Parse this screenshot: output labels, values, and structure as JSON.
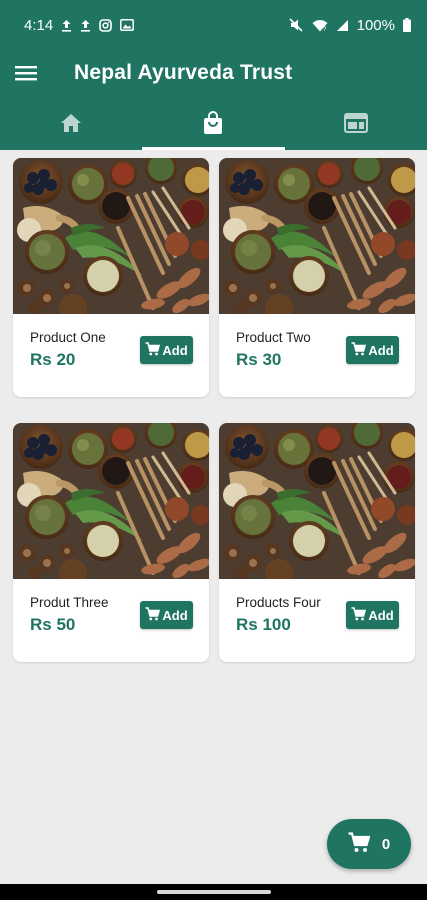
{
  "status_bar": {
    "time": "4:14",
    "battery": "100%",
    "left_icons": [
      "upload-icon",
      "upload-icon",
      "instagram-icon",
      "image-icon"
    ],
    "right_icons": [
      "mute-icon",
      "wifi-icon",
      "signal-icon",
      "battery-icon"
    ]
  },
  "app_bar": {
    "title": "Nepal Ayurveda Trust",
    "menu_icon": "hamburger-menu-icon"
  },
  "tabs": [
    {
      "icon": "home-icon",
      "active": false
    },
    {
      "icon": "shopping-bag-icon",
      "active": true
    },
    {
      "icon": "web-layout-icon",
      "active": false
    }
  ],
  "products": [
    {
      "name": "Product One",
      "price": "Rs 20",
      "button_label": "Add"
    },
    {
      "name": "Product Two",
      "price": "Rs 30",
      "button_label": "Add"
    },
    {
      "name": "Produt Three",
      "price": "Rs 50",
      "button_label": "Add"
    },
    {
      "name": "Products Four",
      "price": "Rs 100",
      "button_label": "Add"
    }
  ],
  "cart": {
    "count": "0",
    "icon": "cart-icon"
  },
  "colors": {
    "primary": "#1f7562",
    "background": "#ececec",
    "card": "#ffffff"
  }
}
